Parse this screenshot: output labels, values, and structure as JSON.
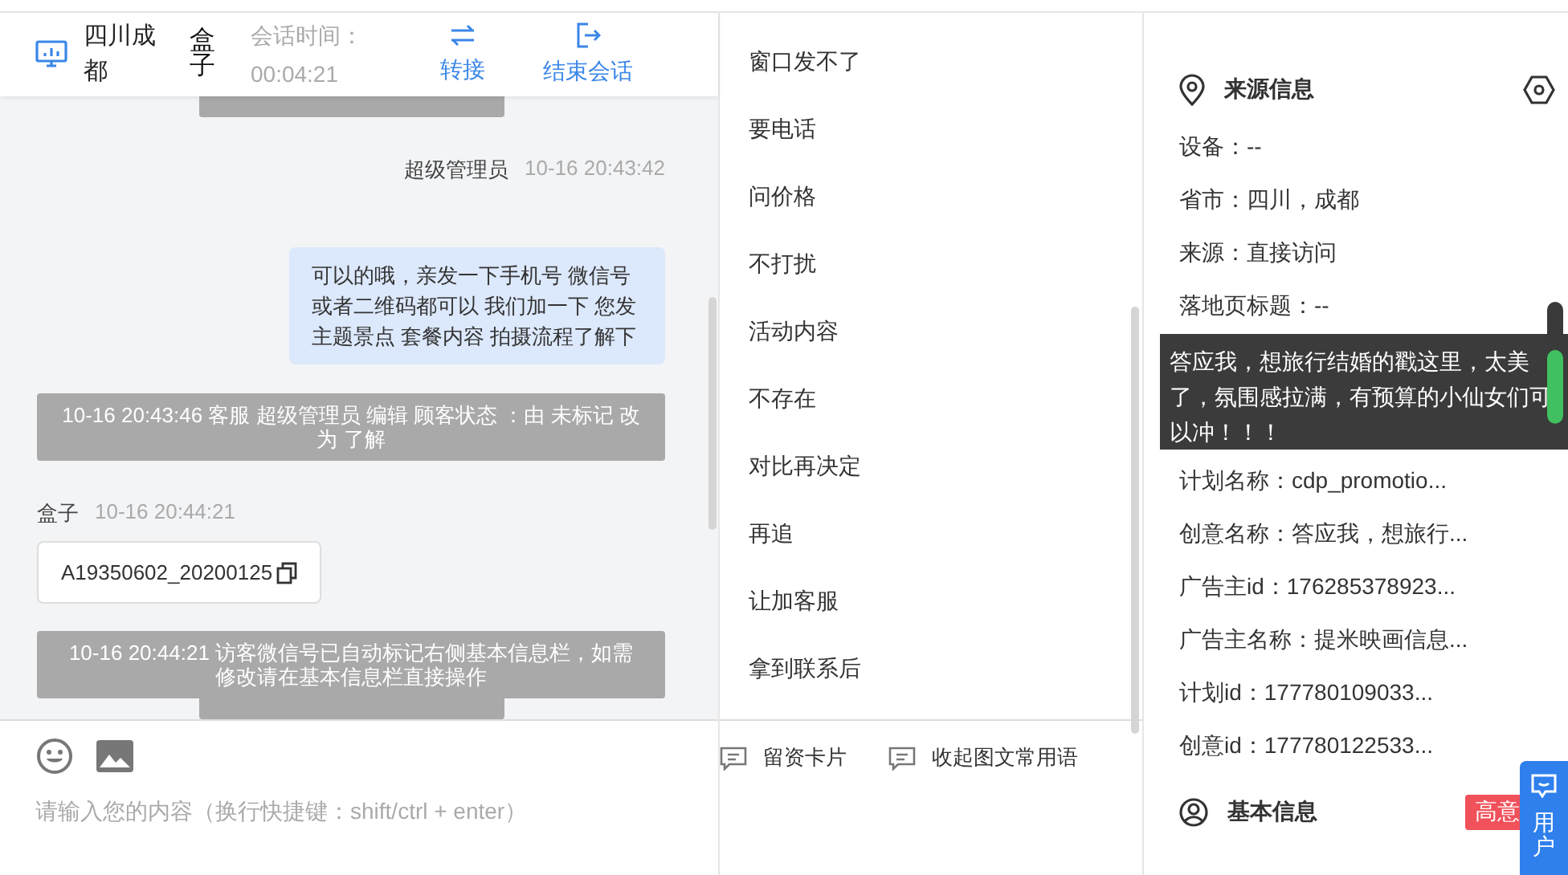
{
  "header": {
    "location": "四川成都",
    "visitor": "盒子",
    "session_label": "会话时间：",
    "session_time": "00:04:21",
    "actions": [
      {
        "kind": "transfer",
        "label": "转接"
      },
      {
        "kind": "end",
        "label": "结束会话"
      }
    ]
  },
  "messages": [
    {
      "kind": "stub"
    },
    {
      "kind": "agent",
      "sender": "超级管理员",
      "time": "10-16 20:43:42",
      "text": "可以的哦，亲发一下手机号 微信号或者二维码都可以 我们加一下 您发主题景点 套餐内容 拍摄流程了解下"
    },
    {
      "kind": "system",
      "text": "10-16 20:43:46 客服 超级管理员 编辑 顾客状态 ：由 未标记 改为 了解"
    },
    {
      "kind": "visitor",
      "sender": "盒子",
      "time": "10-16 20:44:21",
      "text": "A19350602_20200125"
    },
    {
      "kind": "system",
      "text": "10-16 20:44:21 访客微信号已自动标记右侧基本信息栏，如需修改请在基本信息栏直接操作"
    },
    {
      "kind": "stub"
    }
  ],
  "input": {
    "placeholder": "请输入您的内容（换行快捷键：shift/ctrl + enter）"
  },
  "quick_replies": [
    "窗口发不了",
    "要电话",
    "问价格",
    "不打扰",
    "活动内容",
    "不存在",
    "对比再决定",
    "再追",
    "让加客服",
    "拿到联系后"
  ],
  "footer_actions": [
    "留资卡片",
    "收起图文常用语"
  ],
  "source_info": {
    "title": "来源信息",
    "rows": [
      {
        "kind": "text",
        "text": "设备：--"
      },
      {
        "kind": "text",
        "text": "省市：四川，成都"
      },
      {
        "kind": "text",
        "text": "来源：直接访问"
      },
      {
        "kind": "text",
        "text": "落地页标题：--"
      },
      {
        "kind": "hidden"
      },
      {
        "kind": "text",
        "text": "计划名称：cdp_promotio..."
      },
      {
        "kind": "text",
        "text": "创意名称：答应我，想旅行..."
      },
      {
        "kind": "text",
        "text": "广告主id：176285378923..."
      },
      {
        "kind": "text",
        "text": "广告主名称：提米映画信息..."
      },
      {
        "kind": "text",
        "text": "计划id：177780109033..."
      },
      {
        "kind": "text",
        "text": "创意id：177780122533..."
      }
    ],
    "tooltip": "答应我，想旅行结婚的戳这里，太美了，氛围感拉满，有预算的小仙女们可以冲！！！"
  },
  "basic_info": {
    "title": "基本信息",
    "tag": "高意"
  },
  "float_button": {
    "label": "用户"
  }
}
